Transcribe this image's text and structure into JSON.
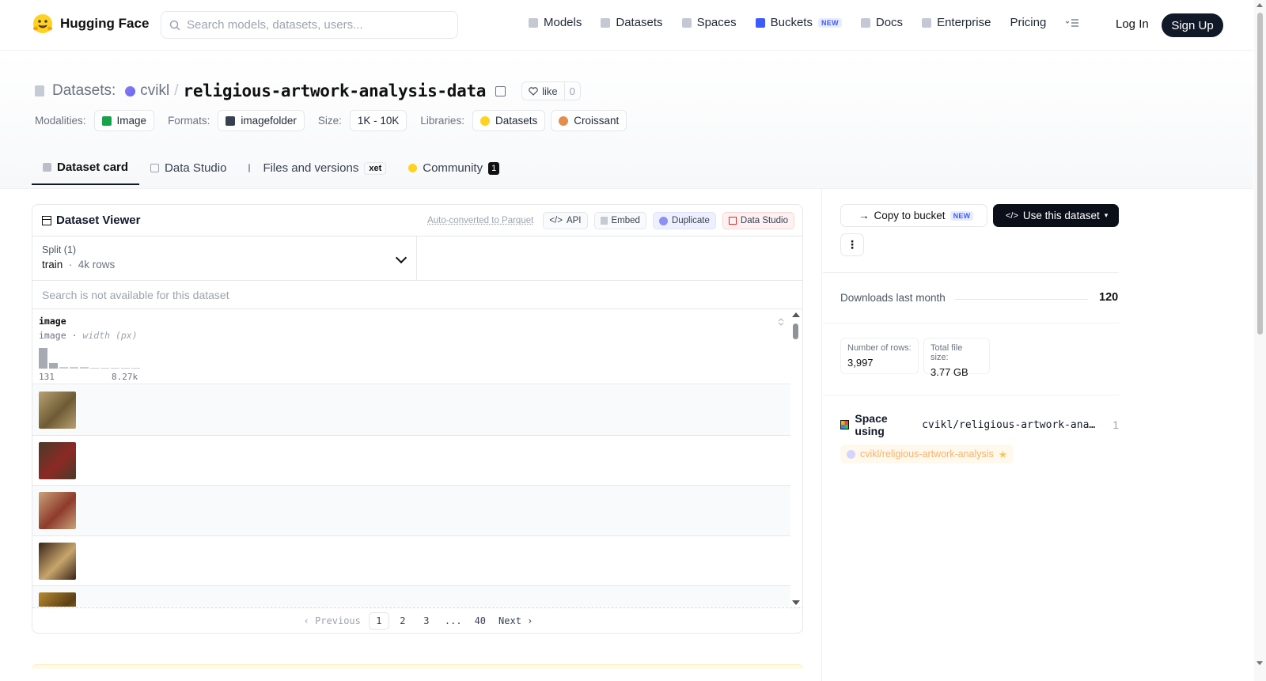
{
  "nav": {
    "brand": "Hugging Face",
    "search_placeholder": "Search models, datasets, users...",
    "links": [
      {
        "label": "Models",
        "icon": "models-icon"
      },
      {
        "label": "Datasets",
        "icon": "datasets-icon"
      },
      {
        "label": "Spaces",
        "icon": "spaces-icon"
      },
      {
        "label": "Buckets",
        "icon": "buckets-icon",
        "badge": "NEW"
      },
      {
        "label": "Docs",
        "icon": "docs-icon"
      },
      {
        "label": "Enterprise",
        "icon": "enterprise-icon"
      },
      {
        "label": "Pricing"
      }
    ],
    "login": "Log In",
    "signup": "Sign Up"
  },
  "repo": {
    "prefix": "Datasets:",
    "owner": "cvikl",
    "separator": "/",
    "name": "religious-artwork-analysis-data",
    "like_label": "like",
    "like_count": "0"
  },
  "meta": {
    "modalities_label": "Modalities:",
    "modality": "Image",
    "formats_label": "Formats:",
    "format": "imagefolder",
    "size_label": "Size:",
    "size": "1K - 10K",
    "libraries_label": "Libraries:",
    "libraries": [
      "Datasets",
      "Croissant"
    ]
  },
  "tabs": [
    {
      "label": "Dataset card",
      "active": true
    },
    {
      "label": "Data Studio"
    },
    {
      "label": "Files and versions",
      "badge": "xet"
    },
    {
      "label": "Community",
      "count": "1"
    }
  ],
  "viewer": {
    "title": "Dataset Viewer",
    "auto_converted": "Auto-converted to Parquet",
    "buttons": [
      "API",
      "Embed",
      "Duplicate",
      "Data Studio"
    ],
    "split_label": "Split (1)",
    "split_value": "train",
    "split_rows": "4k rows",
    "search_note": "Search is not available for this dataset",
    "column": {
      "name": "image",
      "type": "image",
      "subtype": "width (px)",
      "min": "131",
      "max": "8.27k",
      "histogram": [
        1.0,
        0.28,
        0.08,
        0.06,
        0.06,
        0.05,
        0.05,
        0.05,
        0.05,
        0.05
      ]
    },
    "thumb_colors": [
      [
        "#b8a173",
        "#6e5b34"
      ],
      [
        "#4a3a2a",
        "#8b2a24"
      ],
      [
        "#c9a27a",
        "#8e3b2b"
      ],
      [
        "#3a2418",
        "#c7a56b"
      ],
      [
        "#b88a2f",
        "#5c4116"
      ]
    ],
    "pager": {
      "previous": "Previous",
      "pages": [
        "1",
        "2",
        "3",
        "...",
        "40"
      ],
      "current": "1",
      "next": "Next"
    }
  },
  "sidebar": {
    "copy_to_bucket": "Copy to bucket",
    "copy_badge": "NEW",
    "use_dataset": "Use this dataset",
    "more": "⋮",
    "downloads_label": "Downloads last month",
    "downloads_value": "120",
    "rows_label": "Number of rows:",
    "rows_value": "3,997",
    "filesize_label": "Total file size:",
    "filesize_value": "3.77 GB",
    "space_title": "Space using",
    "space_repo": "cvikl/religious-artwork-analysis-data",
    "space_count": "1",
    "space_chip": "cvikl/religious-artwork-analysis"
  }
}
